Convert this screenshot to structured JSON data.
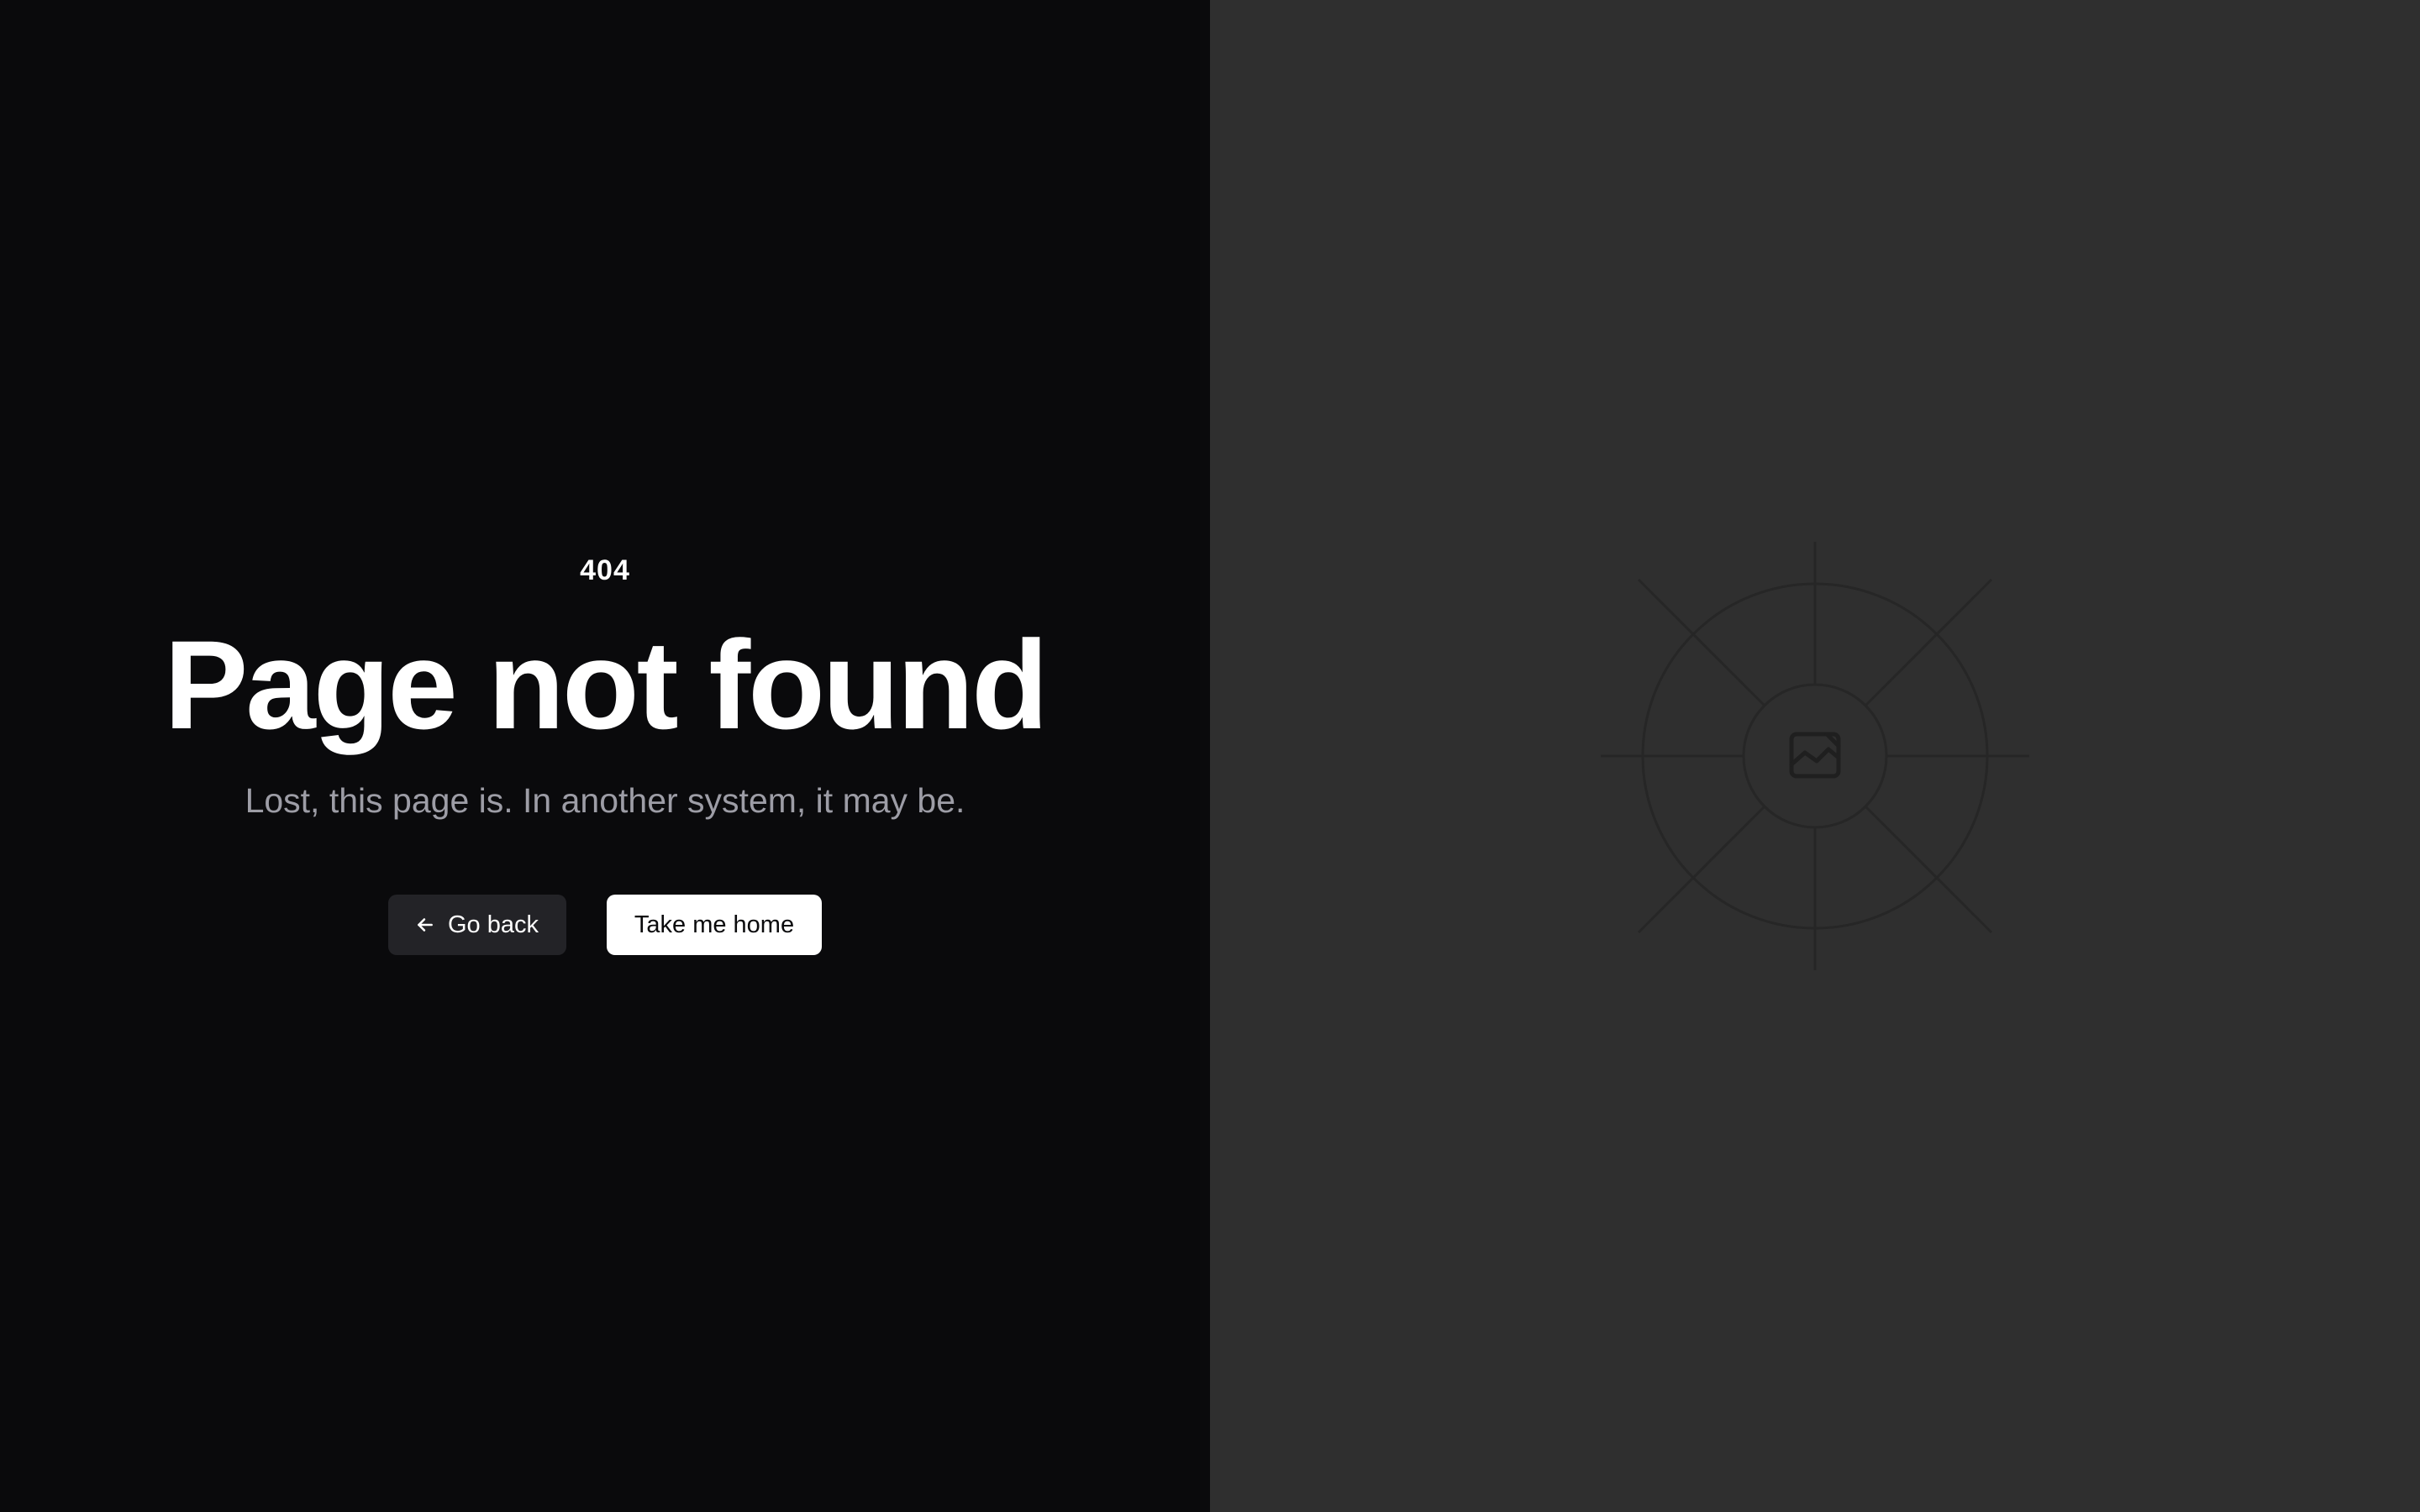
{
  "error": {
    "code": "404",
    "title": "Page not found",
    "message": "Lost, this page is. In another system, it may be."
  },
  "actions": {
    "back_label": "Go back",
    "home_label": "Take me home"
  },
  "icons": {
    "back": "arrow-left-icon",
    "placeholder": "image-placeholder-icon"
  },
  "colors": {
    "left_background": "#0a0a0c",
    "right_background": "#2f2f2f",
    "subtitle": "#9d9da6",
    "back_button": "#232327",
    "home_button": "#ffffff"
  }
}
